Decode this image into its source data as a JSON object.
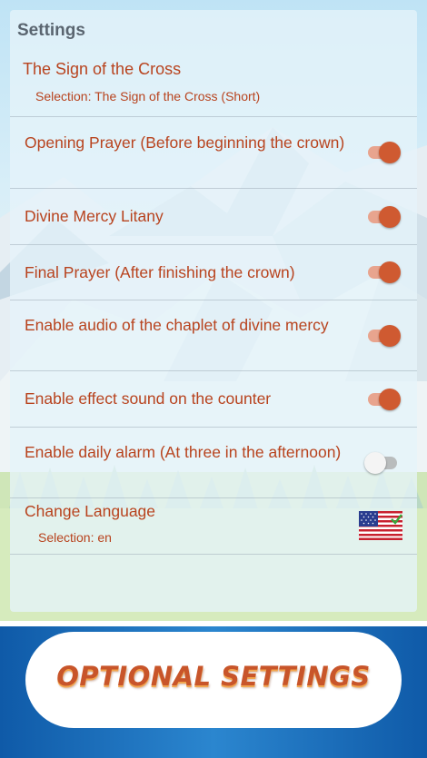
{
  "settings": {
    "title": "Settings",
    "sign_of_cross": {
      "label": "The Sign of the Cross",
      "selection": "Selection: The Sign of the Cross (Short)"
    },
    "toggles": [
      {
        "label": "Opening Prayer (Before beginning the crown)",
        "on": true
      },
      {
        "label": "Divine Mercy Litany",
        "on": true
      },
      {
        "label": "Final Prayer (After finishing the crown)",
        "on": true
      },
      {
        "label": "Enable audio of the chaplet of divine mercy",
        "on": true
      },
      {
        "label": "Enable effect sound on the counter",
        "on": true
      },
      {
        "label": "Enable daily alarm (At three in the afternoon)",
        "on": false
      }
    ],
    "language": {
      "label": "Change Language",
      "selection": "Selection: en",
      "flag_icon": "us-flag-icon"
    }
  },
  "banner": {
    "text": "OPTIONAL SETTINGS"
  },
  "colors": {
    "accent": "#cf5a31",
    "label_text": "#b8431e",
    "banner_blue": "#1a6fb9"
  }
}
